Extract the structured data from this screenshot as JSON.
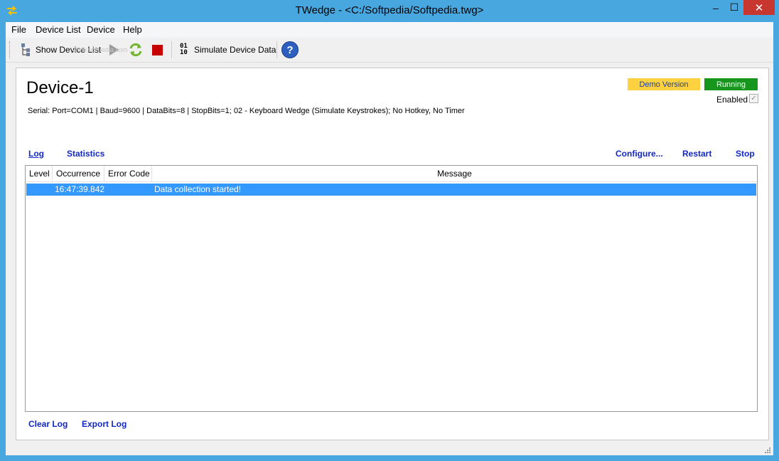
{
  "window": {
    "title": "TWedge - <C:/Softpedia/Softpedia.twg>",
    "minimize_glyph": "‒",
    "maximize_glyph": "☐",
    "close_glyph": "✕"
  },
  "menu": {
    "items": [
      "File",
      "Device List",
      "Device",
      "Help"
    ]
  },
  "toolbar": {
    "show_device_list": "Show Device List",
    "simulate_device_data": "Simulate Device Data",
    "simulate_icon_text_top": "01",
    "simulate_icon_text_bottom": "10",
    "help_glyph": "?",
    "watermark": "www.softpedia.com"
  },
  "device": {
    "name": "Device-1",
    "info": "Serial: Port=COM1 | Baud=9600 | DataBits=8 | StopBits=1; 02 - Keyboard Wedge (Simulate Keystrokes); No Hotkey, No Timer",
    "demo_badge": "Demo Version",
    "status_badge": "Running",
    "enabled_label": "Enabled",
    "enabled_check": "✓",
    "status_color": "#17961d",
    "demo_color": "#fdd13f"
  },
  "links": {
    "log": "Log",
    "statistics": "Statistics",
    "configure": "Configure...",
    "restart": "Restart",
    "stop": "Stop",
    "clear_log": "Clear Log",
    "export_log": "Export Log"
  },
  "log_table": {
    "columns": [
      "Level",
      "Occurrence",
      "Error Code",
      "Message"
    ],
    "rows": [
      {
        "level": "",
        "occurrence": "16:47:39.842",
        "error_code": "",
        "message": "Data collection started!"
      }
    ]
  }
}
